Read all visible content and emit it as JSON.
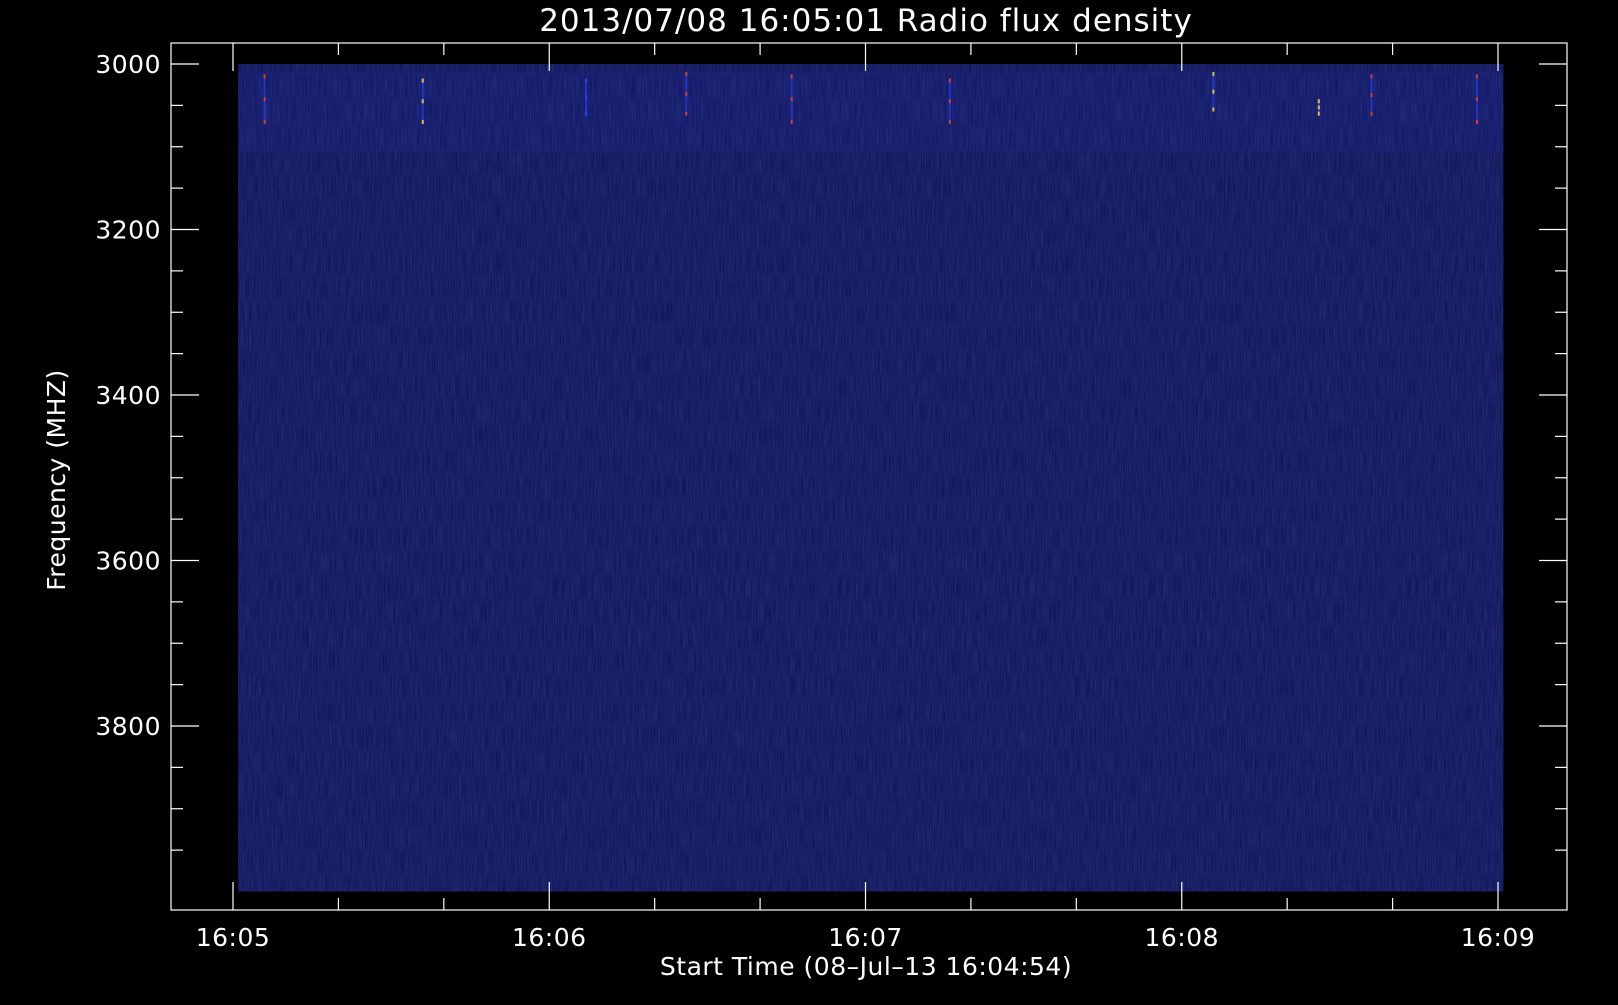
{
  "chart_data": {
    "type": "heatmap",
    "title": "2013/07/08 16:05:01 Radio flux density",
    "xlabel": "Start Time (08–Jul–13 16:04:54)",
    "ylabel": "Frequency (MHZ)",
    "x_tick_labels": [
      "16:05",
      "16:06",
      "16:07",
      "16:08",
      "16:09"
    ],
    "y_tick_labels": [
      "3000",
      "3200",
      "3400",
      "3600",
      "3800"
    ],
    "y_tick_values": [
      3000,
      3200,
      3400,
      3600,
      3800
    ],
    "xlim_seconds_from_1605": [
      0,
      240
    ],
    "ylim": [
      3000,
      4000
    ],
    "y_inverted": true,
    "data_extent": {
      "time_start": "16:05:01",
      "time_end": "16:09:01",
      "freq_start": 3000,
      "freq_end": 4000
    },
    "colors": {
      "background": "#000000",
      "axes": "#ffffff",
      "field": "#0a0f52",
      "burst_red": "#d2402a",
      "burst_yellow": "#e0c040",
      "burst_blue": "#2a40ff"
    },
    "bursts": [
      {
        "time": "16:05:06",
        "freq_start": 3015,
        "freq_end": 3070,
        "color": "red"
      },
      {
        "time": "16:05:36",
        "freq_start": 3020,
        "freq_end": 3070,
        "color": "yellow"
      },
      {
        "time": "16:06:07",
        "freq_start": 3020,
        "freq_end": 3060,
        "color": "blue"
      },
      {
        "time": "16:06:26",
        "freq_start": 3012,
        "freq_end": 3060,
        "color": "red"
      },
      {
        "time": "16:06:46",
        "freq_start": 3015,
        "freq_end": 3070,
        "color": "red"
      },
      {
        "time": "16:07:16",
        "freq_start": 3020,
        "freq_end": 3070,
        "color": "red"
      },
      {
        "time": "16:08:06",
        "freq_start": 3012,
        "freq_end": 3055,
        "color": "yellow"
      },
      {
        "time": "16:08:26",
        "freq_start": 3045,
        "freq_end": 3060,
        "color": "yellow"
      },
      {
        "time": "16:08:36",
        "freq_start": 3015,
        "freq_end": 3060,
        "color": "red"
      },
      {
        "time": "16:08:56",
        "freq_start": 3015,
        "freq_end": 3070,
        "color": "red"
      }
    ]
  }
}
